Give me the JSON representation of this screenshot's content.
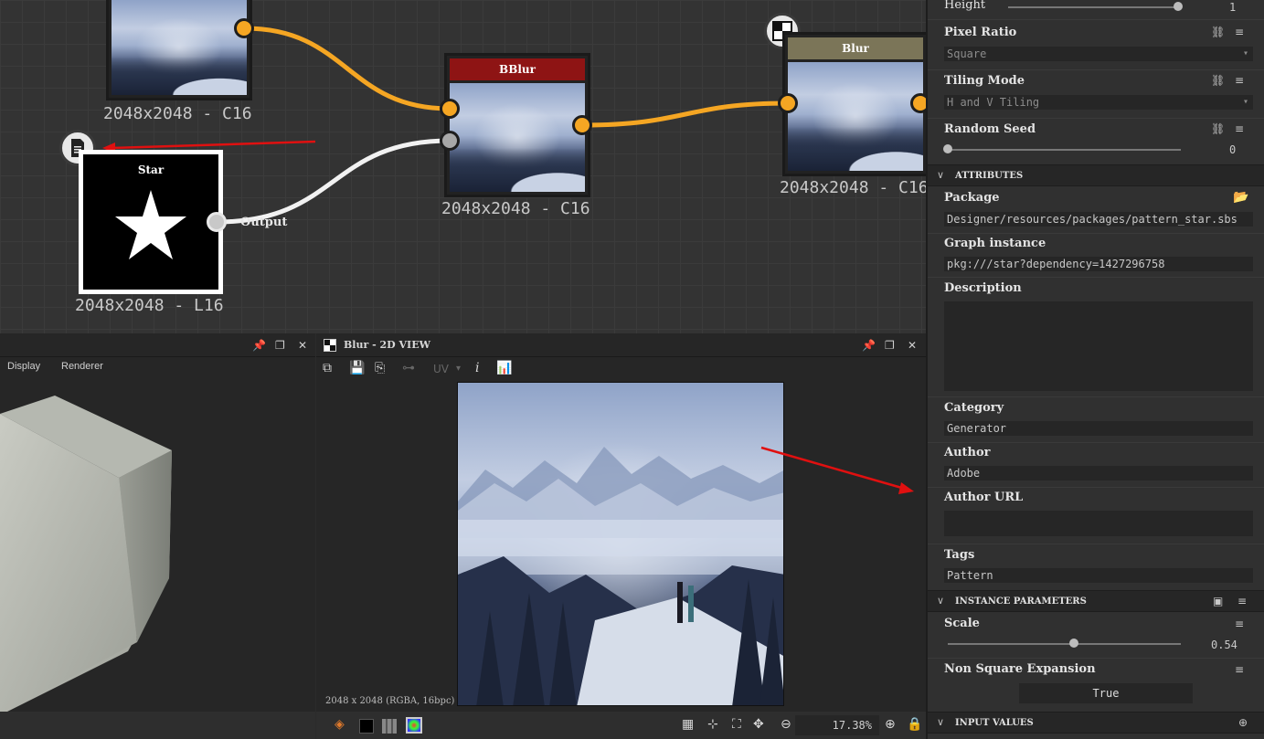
{
  "graph": {
    "top_node": {
      "resolution": "2048x2048 - C16"
    },
    "bblur_node": {
      "title": "BBlur",
      "resolution": "2048x2048 - C16"
    },
    "blur_node": {
      "title": "Blur",
      "resolution": "2048x2048 - C16"
    },
    "star_node": {
      "title": "Star",
      "resolution": "2048x2048 - L16",
      "output_label": "Output"
    }
  },
  "view3d": {
    "menu": [
      "Display",
      "Renderer"
    ]
  },
  "view2d": {
    "title": "Blur - 2D VIEW",
    "uv_label": "UV",
    "image_info": "2048 x 2048 (RGBA, 16bpc)",
    "zoom": "17.38%"
  },
  "properties": {
    "height": {
      "label": "Height",
      "value": "1",
      "fraction": 0.98
    },
    "pixel_ratio": {
      "label": "Pixel Ratio",
      "value": "Square"
    },
    "tiling_mode": {
      "label": "Tiling Mode",
      "value": "H and V Tiling"
    },
    "random_seed": {
      "label": "Random Seed",
      "value": "0",
      "fraction": 0.0
    },
    "attributes": {
      "title": "ATTRIBUTES",
      "package": {
        "label": "Package",
        "value": "Designer/resources/packages/pattern_star.sbs"
      },
      "graph_instance": {
        "label": "Graph instance",
        "value": "pkg:///star?dependency=1427296758"
      },
      "description": {
        "label": "Description",
        "value": ""
      },
      "category": {
        "label": "Category",
        "value": "Generator"
      },
      "author": {
        "label": "Author",
        "value": "Adobe"
      },
      "author_url": {
        "label": "Author URL",
        "value": ""
      },
      "tags": {
        "label": "Tags",
        "value": "Pattern"
      }
    },
    "instance_parameters": {
      "title": "INSTANCE PARAMETERS",
      "scale": {
        "label": "Scale",
        "value": "0.54",
        "fraction": 0.54
      },
      "non_square": {
        "label": "Non Square Expansion",
        "value": "True"
      }
    },
    "input_values": {
      "title": "INPUT VALUES"
    }
  },
  "colors": {
    "accent_orange": "#f5a623",
    "bblur_header": "#8e1414",
    "blur_header": "#7b7558",
    "annotation_red": "#e01010"
  }
}
